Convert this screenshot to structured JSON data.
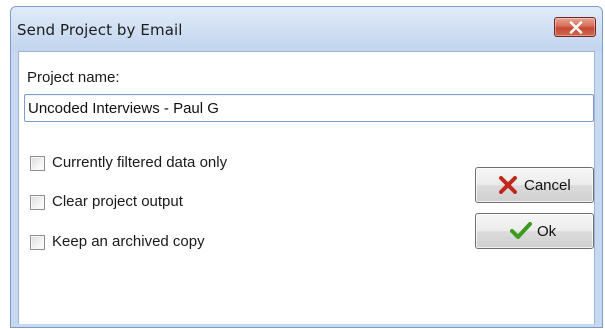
{
  "dialog": {
    "title": "Send Project by Email"
  },
  "project_name": {
    "label": "Project name:",
    "value": "Uncoded Interviews - Paul G"
  },
  "options": [
    {
      "label": "Currently filtered data only",
      "checked": false
    },
    {
      "label": "Clear project output",
      "checked": false
    },
    {
      "label": "Keep an archived copy",
      "checked": false
    }
  ],
  "buttons": {
    "cancel_label": "Cancel",
    "ok_label": "Ok"
  },
  "colors": {
    "title_bar": "#c6d9f1",
    "close_button": "#c34a35",
    "cancel_icon": "#c0281c",
    "ok_icon": "#3c9a1e"
  }
}
